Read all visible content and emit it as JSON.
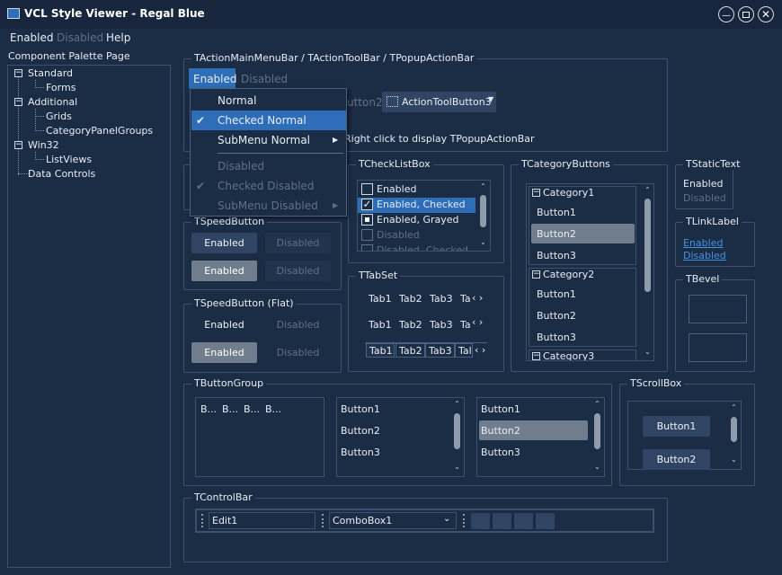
{
  "window": {
    "title": "VCL Style Viewer - Regal Blue"
  },
  "menu": [
    "Enabled",
    "Disabled",
    "Help"
  ],
  "palette": {
    "label": "Component Palette Page",
    "tree": [
      {
        "label": "Standard",
        "expanded": true
      },
      {
        "label": "Forms"
      },
      {
        "label": "Additional",
        "expanded": true
      },
      {
        "label": "Grids"
      },
      {
        "label": "CategoryPanelGroups"
      },
      {
        "label": "Win32",
        "expanded": true
      },
      {
        "label": "ListViews"
      },
      {
        "label": "Data Controls"
      }
    ]
  },
  "action_bars": {
    "caption": "TActionMainMenuBar / TActionToolBar / TPopupActionBar",
    "menu_enabled": "Enabled",
    "menu_disabled": "Disabled",
    "toolbutton2_partial": "utton2",
    "toolbutton3": "ActionToolButton3",
    "hint": "Right click to display TPopupActionBar"
  },
  "popup_menu": [
    {
      "label": "Normal",
      "checked": false,
      "submenu": false,
      "disabled": false
    },
    {
      "label": "Checked Normal",
      "checked": true,
      "submenu": false,
      "disabled": false,
      "selected": true
    },
    {
      "label": "SubMenu Normal",
      "checked": false,
      "submenu": true,
      "disabled": false
    },
    {
      "label": "Disabled",
      "checked": false,
      "submenu": false,
      "disabled": true
    },
    {
      "label": "Checked Disabled",
      "checked": true,
      "submenu": false,
      "disabled": true
    },
    {
      "label": "SubMenu Disabled",
      "checked": false,
      "submenu": true,
      "disabled": true
    }
  ],
  "speed_button": {
    "caption": "TSpeedButton",
    "enabled": "Enabled",
    "disabled": "Disabled"
  },
  "speed_button_flat": {
    "caption": "TSpeedButton (Flat)",
    "enabled": "Enabled",
    "disabled": "Disabled"
  },
  "checklistbox": {
    "caption": "TCheckListBox",
    "items": [
      {
        "label": "Enabled",
        "state": "unchecked"
      },
      {
        "label": "Enabled, Checked",
        "state": "checked",
        "selected": true
      },
      {
        "label": "Enabled, Grayed",
        "state": "grayed"
      },
      {
        "label": "Disabled",
        "state": "disabled"
      },
      {
        "label": "Disabled, Checked",
        "state": "disabled-checked"
      }
    ]
  },
  "tabset": {
    "caption": "TTabSet",
    "tabs": [
      "Tab1",
      "Tab2",
      "Tab3",
      "Ta",
      "Tab1",
      "Tab2",
      "Tab3",
      "Ta",
      "Tab1",
      "Tab2",
      "Tab3",
      "Tal"
    ]
  },
  "category_buttons": {
    "caption": "TCategoryButtons",
    "categories": [
      {
        "name": "Category1",
        "buttons": [
          "Button1",
          "Button2",
          "Button3"
        ]
      },
      {
        "name": "Category2",
        "buttons": [
          "Button1",
          "Button2",
          "Button3"
        ]
      },
      {
        "name": "Category3",
        "buttons": []
      }
    ]
  },
  "static_text": {
    "caption": "TStaticText",
    "enabled": "Enabled",
    "disabled": "Disabled"
  },
  "link_label": {
    "caption": "TLinkLabel",
    "enabled": "Enabled",
    "disabled": "Disabled"
  },
  "bevel": {
    "caption": "TBevel"
  },
  "button_group": {
    "caption": "TButtonGroup",
    "compact": [
      "B...",
      "B...",
      "B...",
      "B..."
    ],
    "list1": [
      "Button1",
      "Button2",
      "Button3"
    ],
    "list2": [
      "Button1",
      "Button2",
      "Button3"
    ]
  },
  "scrollbox": {
    "caption": "TScrollBox",
    "buttons": [
      "Button1",
      "Button2"
    ]
  },
  "controlbar": {
    "caption": "TControlBar",
    "edit": "Edit1",
    "combo": "ComboBox1"
  },
  "colors": {
    "background": "#1b2c45",
    "selection": "#2e6db7",
    "disabled": "#5f7088",
    "link": "#4a90e2"
  }
}
